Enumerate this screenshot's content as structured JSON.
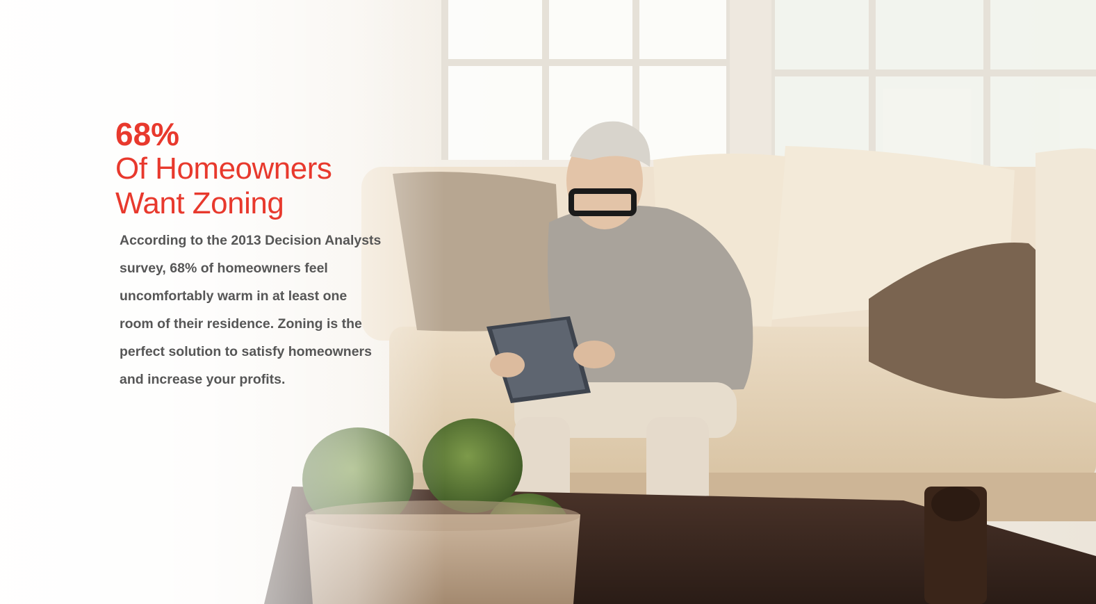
{
  "statistic": "68%",
  "headline_line1": "Of Homeowners",
  "headline_line2": "Want Zoning",
  "body": "According to the 2013 Decision Analysts survey, 68% of homeowners feel uncomfortably warm in at least one room of their residence. Zoning is the perfect solution to satisfy homeowners and increase your profits.",
  "colors": {
    "accent": "#e8392d",
    "body_text": "#565656"
  }
}
